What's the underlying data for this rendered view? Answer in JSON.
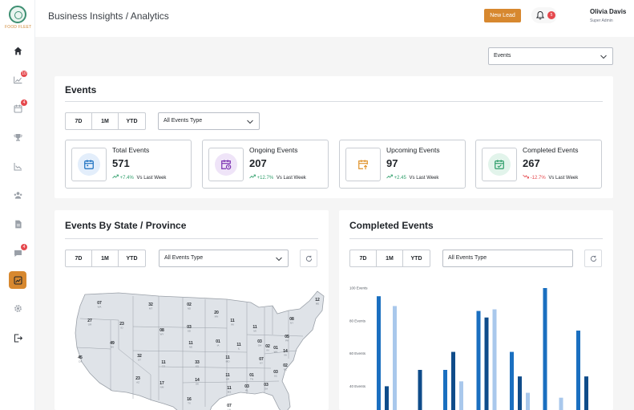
{
  "app": {
    "logo_text": "FOOD FLEET"
  },
  "sidebar": {
    "items": [
      {
        "icon": "home-icon",
        "badge": ""
      },
      {
        "icon": "leads-icon",
        "badge": "10"
      },
      {
        "icon": "calendar-icon",
        "badge": "4"
      },
      {
        "icon": "trophy-icon",
        "badge": ""
      },
      {
        "icon": "chart-line-icon",
        "badge": ""
      },
      {
        "icon": "team-icon",
        "badge": ""
      },
      {
        "icon": "document-icon",
        "badge": ""
      },
      {
        "icon": "chat-icon",
        "badge": "4"
      },
      {
        "icon": "analytics-icon",
        "badge": "",
        "active": true
      },
      {
        "icon": "gear-icon",
        "badge": ""
      },
      {
        "icon": "logout-icon",
        "badge": ""
      }
    ]
  },
  "header": {
    "breadcrumb": "Business Insights / Analytics",
    "new_lead": "New Lead",
    "notifications": "5",
    "user_name": "Olivia Davis",
    "user_role": "Super Admin"
  },
  "filter": {
    "selected": "Events"
  },
  "events": {
    "title": "Events",
    "ranges": [
      "7D",
      "1M",
      "YTD"
    ],
    "type_filter": "All Events Type",
    "stats": [
      {
        "label": "Total Events",
        "value": "571",
        "change": "+7.4%",
        "direction": "up",
        "vs": "Vs Last Week",
        "icon": "calendar-icon",
        "color": "#1a6fc0",
        "bg": "#e3eefb"
      },
      {
        "label": "Ongoing Events",
        "value": "207",
        "change": "+12.7%",
        "direction": "up",
        "vs": "Vs Last Week",
        "icon": "calendar-clock-icon",
        "color": "#7a2fb0",
        "bg": "#efe4f8"
      },
      {
        "label": "Upcoming Events",
        "value": "97",
        "change": "+2.45",
        "direction": "up",
        "vs": "Vs Last Week",
        "icon": "calendar-arrow-icon",
        "color": "#e0932c",
        "bg": "#ffffff"
      },
      {
        "label": "Completed Events",
        "value": "267",
        "change": "-12.7%",
        "direction": "down",
        "vs": "Vs Last Week",
        "icon": "calendar-check-icon",
        "color": "#2e9e6a",
        "bg": "#e2f4eb"
      }
    ]
  },
  "map_card": {
    "title": "Events By State / Province",
    "ranges": [
      "7D",
      "1M",
      "YTD"
    ],
    "type_filter": "All Events Type",
    "states": [
      {
        "value": "07",
        "code": "WA"
      },
      {
        "value": "32",
        "code": "MT"
      },
      {
        "value": "02",
        "code": "ND"
      },
      {
        "value": "20",
        "code": "MN"
      },
      {
        "value": "12",
        "code": "ME"
      },
      {
        "value": "27",
        "code": "OR"
      },
      {
        "value": "23",
        "code": "ID"
      },
      {
        "value": "08",
        "code": "WY"
      },
      {
        "value": "03",
        "code": "SD"
      },
      {
        "value": "11",
        "code": "WI"
      },
      {
        "value": "11",
        "code": "MI"
      },
      {
        "value": "08",
        "code": "NY"
      },
      {
        "value": "49",
        "code": "NV"
      },
      {
        "value": "11",
        "code": "NE"
      },
      {
        "value": "01",
        "code": "IA"
      },
      {
        "value": "05",
        "code": "PA"
      },
      {
        "value": "45",
        "code": "CA"
      },
      {
        "value": "32",
        "code": "UT"
      },
      {
        "value": "11",
        "code": "CO"
      },
      {
        "value": "11",
        "code": "IL"
      },
      {
        "value": "02",
        "code": "IN"
      },
      {
        "value": "03",
        "code": "OH"
      },
      {
        "value": "14",
        "code": "VA"
      },
      {
        "value": "01",
        "code": "WV"
      },
      {
        "value": "33",
        "code": "KS"
      },
      {
        "value": "11",
        "code": "MO"
      },
      {
        "value": "07",
        "code": "KY"
      },
      {
        "value": "02",
        "code": "NC"
      },
      {
        "value": "23",
        "code": "AZ"
      },
      {
        "value": "17",
        "code": "NM"
      },
      {
        "value": "14",
        "code": "OK"
      },
      {
        "value": "11",
        "code": "AR"
      },
      {
        "value": "01",
        "code": "TN"
      },
      {
        "value": "03",
        "code": "SC"
      },
      {
        "value": "11",
        "code": "MS"
      },
      {
        "value": "03",
        "code": "AL"
      },
      {
        "value": "03",
        "code": "GA"
      },
      {
        "value": "16",
        "code": "TX"
      },
      {
        "value": "07",
        "code": "LA"
      }
    ]
  },
  "completed_card": {
    "title": "Completed Events",
    "ranges": [
      "7D",
      "1M",
      "YTD"
    ],
    "type_filter": "All Events Type"
  },
  "chart_data": {
    "type": "bar",
    "title": "Completed Events",
    "ytick_labels": [
      "100 Events",
      "80 Events",
      "60 Events",
      "40 Events"
    ],
    "yticks": [
      100,
      80,
      60,
      40
    ],
    "ylim": [
      25,
      100
    ],
    "series_colors": [
      "#1a6fc0",
      "#0f4c8a",
      "#a9c8ec"
    ],
    "groups": [
      {
        "values": [
          95,
          40,
          89
        ]
      },
      {
        "values": [
          null,
          50,
          null
        ]
      },
      {
        "values": [
          50,
          61,
          43
        ]
      },
      {
        "values": [
          86,
          82,
          87
        ]
      },
      {
        "values": [
          61,
          46,
          36
        ]
      },
      {
        "values": [
          100,
          null,
          33
        ]
      },
      {
        "values": [
          74,
          46,
          null
        ]
      }
    ]
  }
}
